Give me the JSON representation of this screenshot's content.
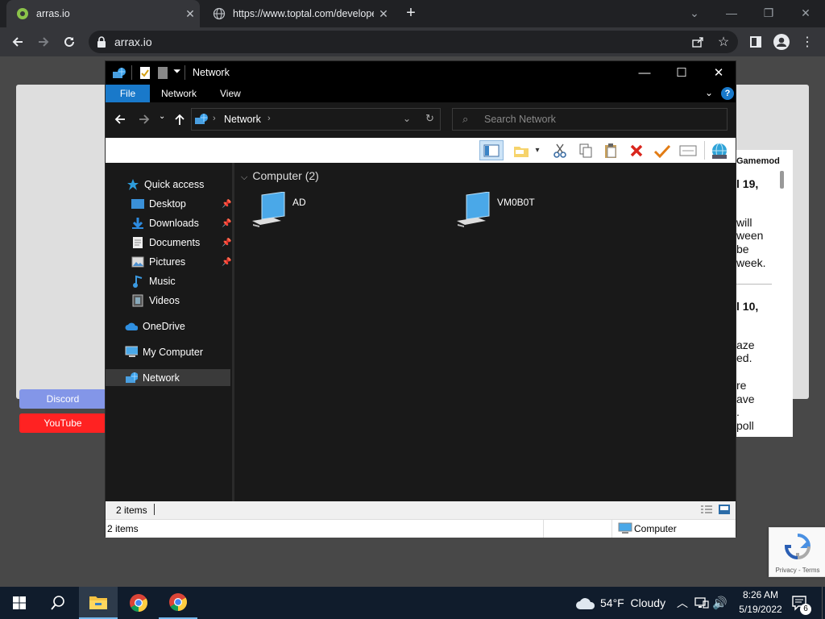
{
  "browser": {
    "tabs": [
      {
        "title": "arras.io",
        "close": "✕"
      },
      {
        "title": "https://www.toptal.com/develope",
        "close": "✕"
      }
    ],
    "new_tab": "+",
    "url": "arrax.io"
  },
  "page": {
    "discord_label": "Discord",
    "youtube_label": "YouTube",
    "news_lines": [
      "Gamemod",
      "l 19,",
      "will",
      "ween",
      "be",
      "week.",
      "l 10,",
      "aze",
      "ed.",
      "re",
      "ave",
      ".",
      "poll"
    ]
  },
  "captcha": {
    "links": "Privacy - Terms"
  },
  "explorer": {
    "title": "Network",
    "ribbon_tabs": [
      "File",
      "Network",
      "View"
    ],
    "address_path": "Network",
    "search_placeholder": "Search Network",
    "nav": {
      "quick_access": "Quick access",
      "pinned": [
        "Desktop",
        "Downloads",
        "Documents",
        "Pictures"
      ],
      "unpinned": [
        "Music",
        "Videos"
      ],
      "onedrive": "OneDrive",
      "my_computer": "My Computer",
      "network": "Network"
    },
    "group_header": "Computer (2)",
    "items": [
      "AD",
      "VM0B0T"
    ],
    "status_items": "2 items",
    "status_items2": "2 items",
    "status_computer": "Computer"
  },
  "taskbar": {
    "weather": "54°F  Cloudy",
    "time": "8:26 AM",
    "date": "5/19/2022",
    "notifications": "6"
  },
  "colors": {
    "accent": "#1979ca",
    "taskbar": "#101c2c"
  }
}
